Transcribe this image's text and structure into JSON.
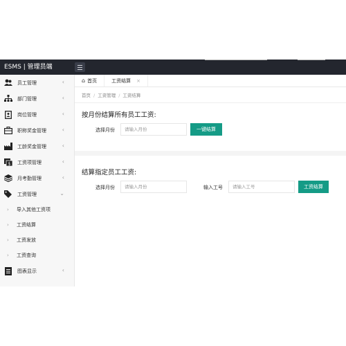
{
  "header": {
    "brand": "ESMS | 管理员端"
  },
  "sidebar": {
    "items": [
      {
        "label": "员工管理",
        "icon": "users-icon"
      },
      {
        "label": "部门管理",
        "icon": "sitemap-icon"
      },
      {
        "label": "岗位管理",
        "icon": "badge-icon"
      },
      {
        "label": "职称奖金管理",
        "icon": "briefcase-icon"
      },
      {
        "label": "工龄奖金管理",
        "icon": "industry-icon"
      },
      {
        "label": "工资项管理",
        "icon": "money-bill-icon"
      },
      {
        "label": "月考勤管理",
        "icon": "layers-icon"
      },
      {
        "label": "工资管理",
        "icon": "tag-icon"
      }
    ],
    "sub_items": [
      {
        "label": "导入其他工资项"
      },
      {
        "label": "工资结算"
      },
      {
        "label": "工资发放"
      },
      {
        "label": "工资查询"
      }
    ],
    "last_item": {
      "label": "图表显示",
      "icon": "document-icon"
    }
  },
  "tabs": [
    {
      "label": "首页"
    },
    {
      "label": "工资结算",
      "close": "×"
    }
  ],
  "breadcrumb": [
    "首页",
    "工资管理",
    "工资结算"
  ],
  "breadcrumb_sep": "/",
  "section1": {
    "title": "按月份结算所有员工工资:",
    "month_label": "选择月份",
    "month_placeholder": "请输入月份",
    "button": "一键结算"
  },
  "section2": {
    "title": "结算指定员工工资:",
    "month_label": "选择月份",
    "month_placeholder": "请输入月份",
    "id_label": "输入工号",
    "id_placeholder": "请输入工号",
    "button": "工资结算"
  },
  "colors": {
    "topbar": "#23262e",
    "accent": "#159b86"
  }
}
